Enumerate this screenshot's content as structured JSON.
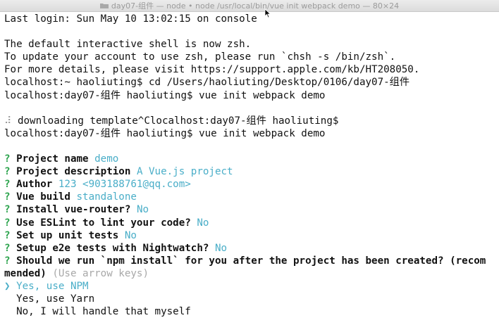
{
  "window": {
    "title": "day07-组件 — node • node /usr/local/bin/vue init webpack demo — 80×24"
  },
  "icons": {
    "folder": "folder-icon",
    "cursor": "mouse-pointer-icon"
  },
  "colors": {
    "question_mark": "#2da44e",
    "answer": "#4aaec8",
    "hint": "#a8a8a8"
  },
  "terminal": {
    "last_login": "Last login: Sun May 10 13:02:15 on console",
    "zsh_notice": "The default interactive shell is now zsh.",
    "zsh_update": "To update your account to use zsh, please run `chsh -s /bin/zsh`.",
    "zsh_details": "For more details, please visit https://support.apple.com/kb/HT208050.",
    "cmd_cd": "localhost:~ haoliuting$ cd /Users/haoliuting/Desktop/0106/day07-组件",
    "cmd_init_1": "localhost:day07-组件 haoliuting$ vue init webpack demo",
    "spinner": "⠼",
    "downloading": " downloading template^Clocalhost:day07-组件 haoliuting$",
    "cmd_init_2": "localhost:day07-组件 haoliuting$ vue init webpack demo",
    "prompts": [
      {
        "mark": "?",
        "question": "Project name",
        "answer": "demo"
      },
      {
        "mark": "?",
        "question": "Project description",
        "answer": "A Vue.js project"
      },
      {
        "mark": "?",
        "question": "Author",
        "answer": "123 <903188761@qq.com>"
      },
      {
        "mark": "?",
        "question": "Vue build",
        "answer": "standalone"
      },
      {
        "mark": "?",
        "question": "Install vue-router?",
        "answer": "No"
      },
      {
        "mark": "?",
        "question": "Use ESLint to lint your code?",
        "answer": "No"
      },
      {
        "mark": "?",
        "question": "Set up unit tests",
        "answer": "No"
      },
      {
        "mark": "?",
        "question": "Setup e2e tests with Nightwatch?",
        "answer": "No"
      }
    ],
    "final_prompt": {
      "mark": "?",
      "question_line1": "Should we run `npm install` for you after the project has been created? (recom",
      "question_line2": "mended)",
      "hint": "(Use arrow keys)"
    },
    "options": {
      "pointer": "❯",
      "selected": "Yes, use NPM",
      "option2": "Yes, use Yarn",
      "option3": "No, I will handle that myself"
    }
  }
}
